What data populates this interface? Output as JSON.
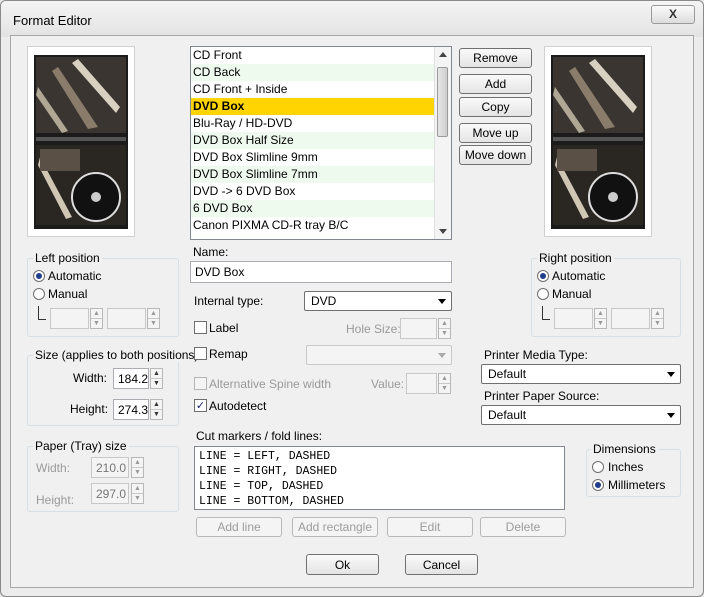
{
  "window": {
    "title": "Format Editor",
    "close_label": "X"
  },
  "format_list": {
    "items": [
      "CD Front",
      "CD Back",
      "CD Front + Inside",
      "DVD Box",
      "Blu-Ray / HD-DVD",
      "DVD Box Half Size",
      "DVD Box Slimline 9mm",
      "DVD Box Slimline 7mm",
      "DVD -> 6 DVD Box",
      "6 DVD Box",
      "Canon PIXMA CD-R tray B/C"
    ],
    "selected": "DVD Box"
  },
  "buttons": {
    "remove": "Remove",
    "add": "Add",
    "copy": "Copy",
    "move_up": "Move up",
    "move_down": "Move down"
  },
  "left_position": {
    "legend": "Left position",
    "automatic": "Automatic",
    "manual": "Manual",
    "selected": "automatic"
  },
  "right_position": {
    "legend": "Right position",
    "automatic": "Automatic",
    "manual": "Manual",
    "selected": "automatic"
  },
  "size": {
    "legend": "Size (applies to both positions)",
    "width_label": "Width:",
    "width_value": "184.2",
    "height_label": "Height:",
    "height_value": "274.3"
  },
  "paper": {
    "legend": "Paper (Tray) size",
    "width_label": "Width:",
    "width_value": "210.0",
    "height_label": "Height:",
    "height_value": "297.0"
  },
  "name": {
    "label": "Name:",
    "value": "DVD Box"
  },
  "internal_type": {
    "label": "Internal type:",
    "value": "DVD"
  },
  "label_check": {
    "label": "Label",
    "checked": false
  },
  "hole_size": {
    "label": "Hole Size:"
  },
  "remap": {
    "label": "Remap",
    "checked": false
  },
  "alt_spine": {
    "label": "Alternative Spine width",
    "checked": false
  },
  "value_field": {
    "label": "Value:"
  },
  "autodetect": {
    "label": "Autodetect",
    "checked": true,
    "mark": "✓"
  },
  "printer_media": {
    "label": "Printer Media Type:",
    "value": "Default"
  },
  "printer_source": {
    "label": "Printer Paper Source:",
    "value": "Default"
  },
  "cut_markers": {
    "label": "Cut markers / fold lines:",
    "lines": [
      "LINE = LEFT, DASHED",
      "LINE = RIGHT, DASHED",
      "LINE = TOP, DASHED",
      "LINE = BOTTOM, DASHED"
    ],
    "add_line": "Add line",
    "add_rectangle": "Add rectangle",
    "edit": "Edit",
    "delete": "Delete"
  },
  "dimensions": {
    "legend": "Dimensions",
    "inches": "Inches",
    "millimeters": "Millimeters",
    "selected": "millimeters"
  },
  "dialog": {
    "ok": "Ok",
    "cancel": "Cancel"
  },
  "colors": {
    "selection": "#ffd400",
    "alt_row": "#eefaee"
  }
}
